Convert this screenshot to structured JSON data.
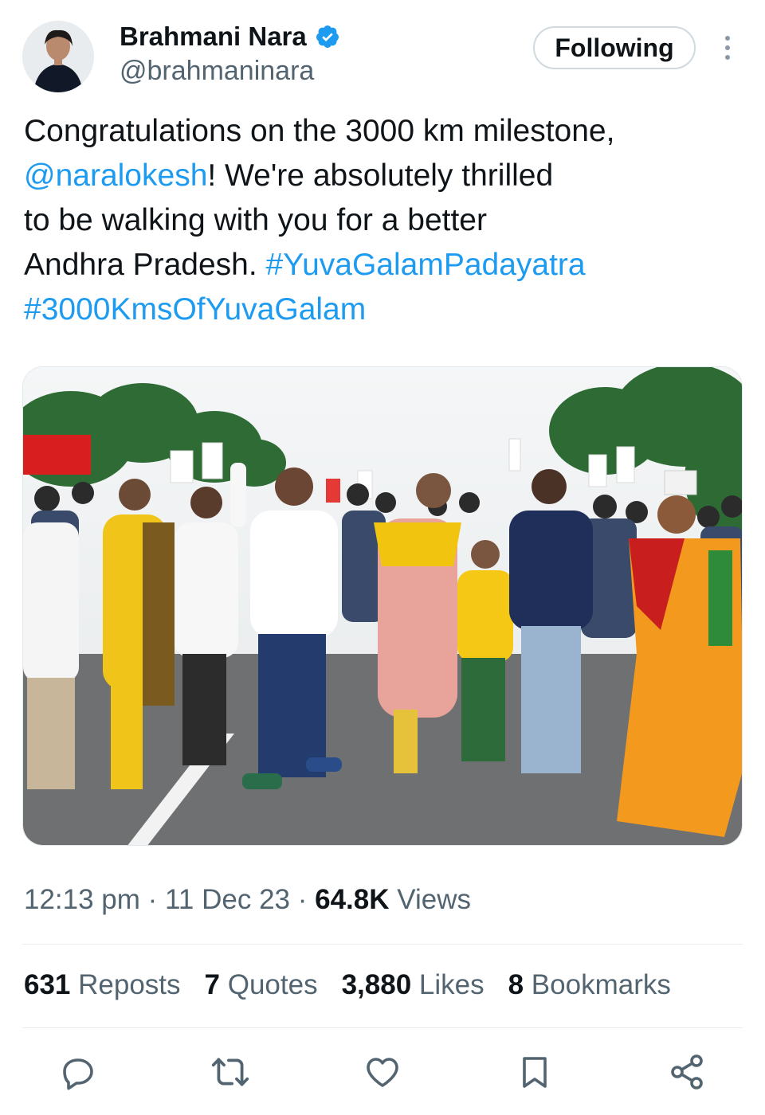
{
  "user": {
    "display_name": "Brahmani Nara",
    "handle": "@brahmaninara",
    "verified": true,
    "follow_label": "Following"
  },
  "tweet": {
    "line1": "Congratulations on the 3000 km milestone,",
    "mention": "@naralokesh",
    "line2_rest": "! We're absolutely thrilled",
    "line3": "to be walking with you for a better",
    "line4_text": "Andhra Pradesh. ",
    "hashtag1": "#YuvaGalamPadayatra",
    "hashtag2": "#3000KmsOfYuvaGalam"
  },
  "meta": {
    "time": "12:13 pm",
    "sep1": " · ",
    "date": "11 Dec 23",
    "sep2": " · ",
    "views_count": "64.8K",
    "views_label": " Views"
  },
  "stats": [
    {
      "count": "631",
      "label": " Reposts"
    },
    {
      "count": "7",
      "label": " Quotes"
    },
    {
      "count": "3,880",
      "label": " Likes"
    },
    {
      "count": "8",
      "label": " Bookmarks"
    }
  ],
  "icons": {
    "verified": "verified-badge-icon",
    "more": "more-vertical-icon",
    "reply": "reply-icon",
    "repost": "repost-icon",
    "like": "like-icon",
    "bookmark": "bookmark-icon",
    "share": "share-icon"
  },
  "colors": {
    "link": "#1d9bf0",
    "text": "#0f1419",
    "secondary": "#536471",
    "icon": "#536471"
  }
}
